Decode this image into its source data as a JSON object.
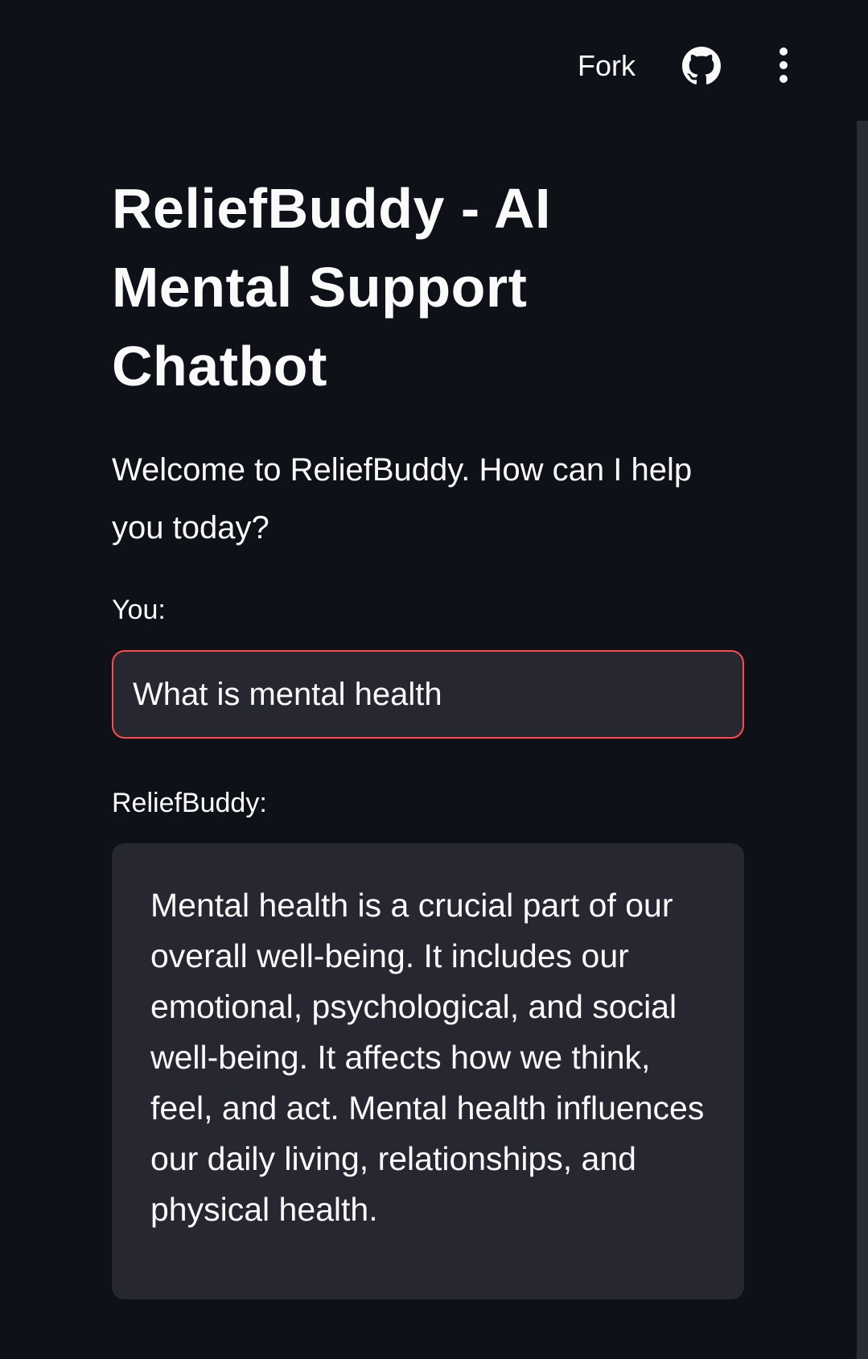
{
  "toolbar": {
    "fork_label": "Fork",
    "github_icon": "github-icon",
    "menu_icon": "vertical-dots-icon"
  },
  "page": {
    "title": "ReliefBuddy - AI Mental Support Chatbot",
    "welcome_text": "Welcome to ReliefBuddy. How can I help you today?"
  },
  "input": {
    "label": "You:",
    "value": "What is mental health"
  },
  "response": {
    "label": "ReliefBuddy:",
    "text": "Mental health is a crucial part of our overall well-being. It includes our emotional, psychological, and social well-being. It affects how we think, feel, and act. Mental health influences our daily living, relationships, and physical health."
  },
  "colors": {
    "background": "#0e1117",
    "surface": "#262730",
    "focus_border": "#ff4b4b",
    "text": "#fafafa"
  }
}
